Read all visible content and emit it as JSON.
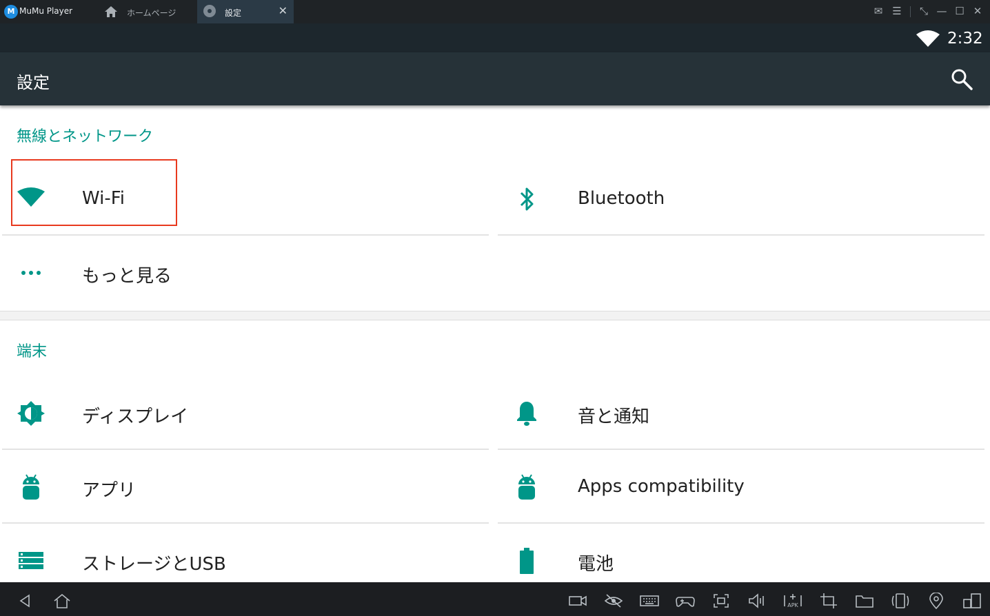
{
  "window": {
    "app_name": "MuMu Player",
    "logo_text": "M",
    "tabs": [
      {
        "label": "ホームページ",
        "icon": "home-icon",
        "active": false
      },
      {
        "label": "設定",
        "icon": "gear-icon",
        "active": true
      }
    ],
    "close_tab_glyph": "✕",
    "controls": [
      "mail-icon",
      "menu-icon",
      "pin-icon",
      "minimize-icon",
      "maximize-icon",
      "close-icon"
    ],
    "control_glyphs": {
      "mail": "✉",
      "menu": "☰",
      "pin": "⤡",
      "minimize": "—",
      "maximize": "☐",
      "close": "✕"
    }
  },
  "status_bar": {
    "time": "2:32",
    "icons": [
      "wifi-icon"
    ]
  },
  "action_bar": {
    "title": "設定",
    "search_icon": "search-icon"
  },
  "accent_color": "#009688",
  "sections": [
    {
      "header": "無線とネットワーク",
      "items": [
        {
          "label": "Wi-Fi",
          "icon": "wifi-icon"
        },
        {
          "label": "Bluetooth",
          "icon": "bluetooth-icon"
        },
        {
          "label": "もっと見る",
          "icon": "more-icon"
        }
      ]
    },
    {
      "header": "端末",
      "items": [
        {
          "label": "ディスプレイ",
          "icon": "brightness-icon"
        },
        {
          "label": "音と通知",
          "icon": "bell-icon"
        },
        {
          "label": "アプリ",
          "icon": "android-icon"
        },
        {
          "label": "Apps compatibility",
          "icon": "android-icon"
        },
        {
          "label": "ストレージとUSB",
          "icon": "storage-icon"
        },
        {
          "label": "電池",
          "icon": "battery-icon"
        }
      ]
    }
  ],
  "highlighted_item": "Wi-Fi",
  "bottom_toolbar": {
    "left": [
      "back-icon",
      "home-icon"
    ],
    "right": [
      "video-record-icon",
      "hide-icon",
      "keyboard-icon",
      "gamepad-icon",
      "screenshot-icon",
      "volume-icon",
      "apk-install-icon",
      "crop-icon",
      "folder-icon",
      "rotate-icon",
      "location-icon",
      "multi-window-icon"
    ],
    "apk_label": "APK"
  }
}
